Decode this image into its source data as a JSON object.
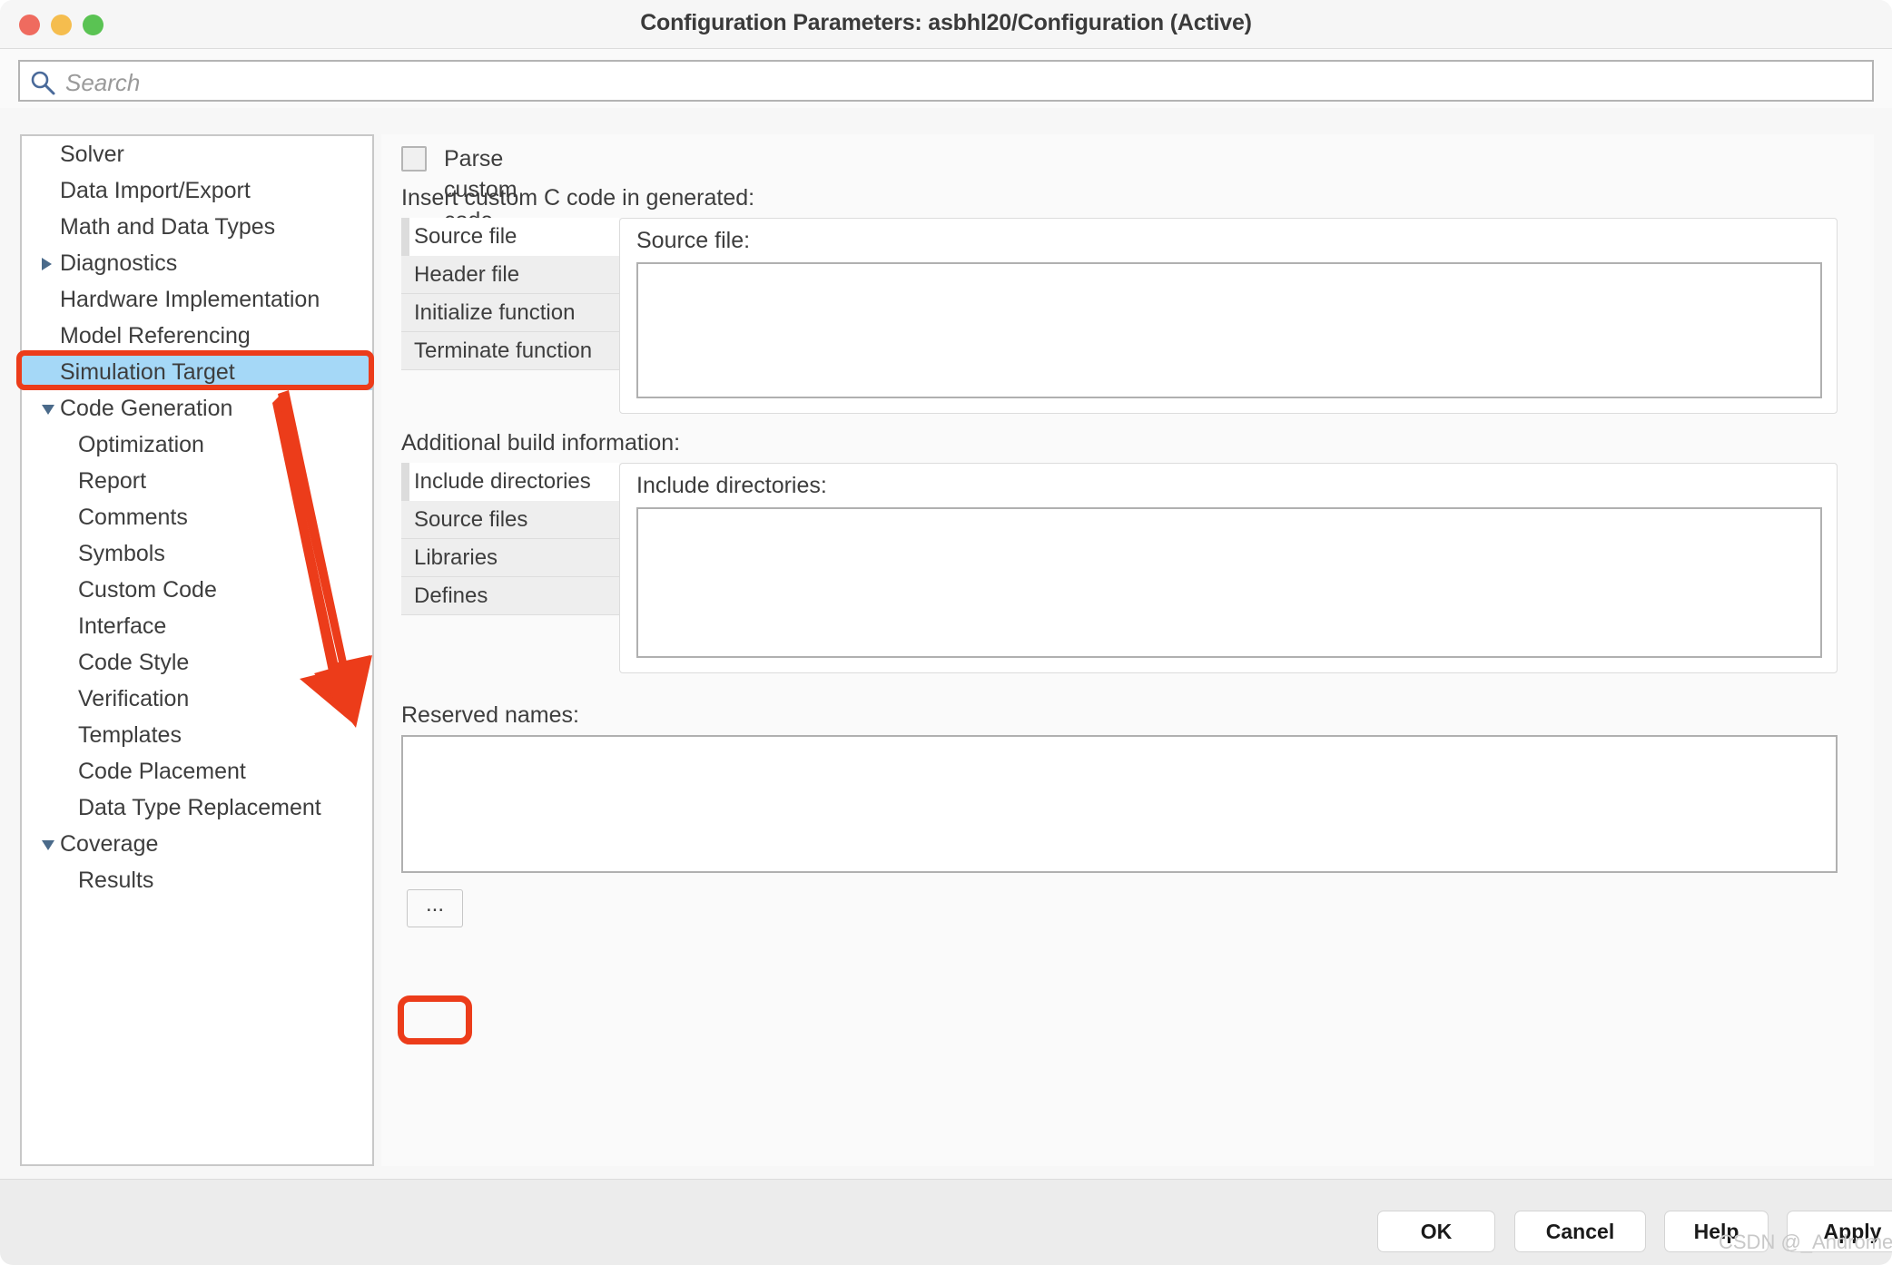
{
  "window": {
    "title": "Configuration Parameters: asbhl20/Configuration (Active)",
    "traffic_lights": [
      "close",
      "minimize",
      "zoom"
    ]
  },
  "search": {
    "placeholder": "Search",
    "value": "",
    "icon": "search-icon"
  },
  "sidebar": {
    "items": [
      {
        "label": "Solver",
        "depth": 0,
        "disclosure": "none",
        "selected": false
      },
      {
        "label": "Data Import/Export",
        "depth": 0,
        "disclosure": "none",
        "selected": false
      },
      {
        "label": "Math and Data Types",
        "depth": 0,
        "disclosure": "none",
        "selected": false
      },
      {
        "label": "Diagnostics",
        "depth": 0,
        "disclosure": "collapsed",
        "selected": false
      },
      {
        "label": "Hardware Implementation",
        "depth": 0,
        "disclosure": "none",
        "selected": false
      },
      {
        "label": "Model Referencing",
        "depth": 0,
        "disclosure": "none",
        "selected": false
      },
      {
        "label": "Simulation Target",
        "depth": 0,
        "disclosure": "none",
        "selected": true
      },
      {
        "label": "Code Generation",
        "depth": 0,
        "disclosure": "expanded",
        "selected": false
      },
      {
        "label": "Optimization",
        "depth": 1,
        "disclosure": "none",
        "selected": false
      },
      {
        "label": "Report",
        "depth": 1,
        "disclosure": "none",
        "selected": false
      },
      {
        "label": "Comments",
        "depth": 1,
        "disclosure": "none",
        "selected": false
      },
      {
        "label": "Symbols",
        "depth": 1,
        "disclosure": "none",
        "selected": false
      },
      {
        "label": "Custom Code",
        "depth": 1,
        "disclosure": "none",
        "selected": false
      },
      {
        "label": "Interface",
        "depth": 1,
        "disclosure": "none",
        "selected": false
      },
      {
        "label": "Code Style",
        "depth": 1,
        "disclosure": "none",
        "selected": false
      },
      {
        "label": "Verification",
        "depth": 1,
        "disclosure": "none",
        "selected": false
      },
      {
        "label": "Templates",
        "depth": 1,
        "disclosure": "none",
        "selected": false
      },
      {
        "label": "Code Placement",
        "depth": 1,
        "disclosure": "none",
        "selected": false
      },
      {
        "label": "Data Type Replacement",
        "depth": 1,
        "disclosure": "none",
        "selected": false
      },
      {
        "label": "Coverage",
        "depth": 0,
        "disclosure": "expanded",
        "selected": false
      },
      {
        "label": "Results",
        "depth": 1,
        "disclosure": "none",
        "selected": false
      }
    ]
  },
  "main": {
    "parse_checkbox": {
      "label": "Parse custom code symbols",
      "checked": false
    },
    "custom_code": {
      "section_label": "Insert custom C code in generated:",
      "tabs": [
        {
          "label": "Source file",
          "active": true
        },
        {
          "label": "Header file",
          "active": false
        },
        {
          "label": "Initialize function",
          "active": false
        },
        {
          "label": "Terminate function",
          "active": false
        }
      ],
      "panel_label": "Source file:",
      "panel_value": ""
    },
    "build_info": {
      "section_label": "Additional build information:",
      "tabs": [
        {
          "label": "Include directories",
          "active": true
        },
        {
          "label": "Source files",
          "active": false
        },
        {
          "label": "Libraries",
          "active": false
        },
        {
          "label": "Defines",
          "active": false
        }
      ],
      "panel_label": "Include directories:",
      "panel_value": ""
    },
    "reserved_names": {
      "label": "Reserved names:",
      "value": "",
      "browse_button": "..."
    }
  },
  "footer": {
    "buttons": [
      {
        "id": "ok",
        "label": "OK"
      },
      {
        "id": "cancel",
        "label": "Cancel"
      },
      {
        "id": "help",
        "label": "Help"
      },
      {
        "id": "apply",
        "label": "Apply"
      }
    ]
  },
  "watermark": {
    "text": "CSDN @_Andromeda"
  },
  "annotations": {
    "color": "#ec3c1a",
    "highlight_tree_item": "Simulation Target",
    "highlight_button": "...",
    "arrow": "points from Simulation Target down to the ... browse button"
  },
  "colors": {
    "selection_blue": "#a5d8f7",
    "annotation_red": "#ec3c1a",
    "window_bg": "#f7f7f7",
    "panel_bg": "#fafafa",
    "footer_bg": "#ececec"
  }
}
